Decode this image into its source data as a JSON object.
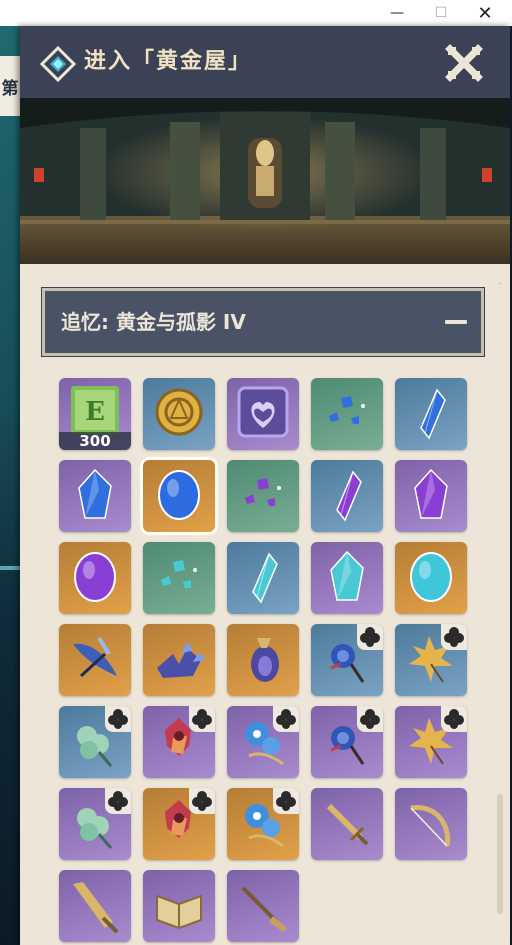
{
  "window": {
    "minimize_glyph": "—",
    "maximize_glyph": "☐",
    "close_glyph": "✕"
  },
  "background": {
    "side_tab_char": "第"
  },
  "panel": {
    "title": "进入「黄金屋」",
    "section_title": "追忆: 黄金与孤影 IV",
    "collapse_glyph": "—"
  },
  "rewards": [
    {
      "name": "adventure-exp-icon",
      "bg": "purple",
      "qty": "300",
      "color": "#7fbf5a"
    },
    {
      "name": "mora-coin-icon",
      "bg": "blue",
      "color": "#e0b243"
    },
    {
      "name": "companionship-exp-icon",
      "bg": "purple",
      "color": "#b7a6f0"
    },
    {
      "name": "hydro-gem-fragments-icon",
      "bg": "green",
      "color": "#2f6fe0"
    },
    {
      "name": "hydro-gem-sliver-icon",
      "bg": "blue",
      "color": "#2f6fe0"
    },
    {
      "name": "hydro-gem-fragment-icon",
      "bg": "purple",
      "color": "#2f6fe0"
    },
    {
      "name": "hydro-gem-chunk-icon",
      "bg": "gold",
      "selected": true,
      "color": "#2d6be0"
    },
    {
      "name": "electro-gem-fragments-icon",
      "bg": "green",
      "color": "#8a3fd4"
    },
    {
      "name": "electro-gem-sliver-icon",
      "bg": "blue",
      "color": "#8a3fd4"
    },
    {
      "name": "electro-gem-fragment-icon",
      "bg": "purple",
      "color": "#8a3fd4"
    },
    {
      "name": "electro-gem-chunk-icon",
      "bg": "gold",
      "color": "#8a3fd4"
    },
    {
      "name": "cryo-gem-fragments-icon",
      "bg": "green",
      "color": "#49c9d6"
    },
    {
      "name": "cryo-gem-sliver-icon",
      "bg": "blue",
      "color": "#49c9d6"
    },
    {
      "name": "cryo-gem-fragment-icon",
      "bg": "purple",
      "color": "#49c9d6"
    },
    {
      "name": "cryo-gem-chunk-icon",
      "bg": "gold",
      "color": "#3fc6d8"
    },
    {
      "name": "feather-artifact-blue-icon",
      "bg": "gold",
      "color": "#3e5fb8"
    },
    {
      "name": "flower-artifact-blue-icon",
      "bg": "gold",
      "color": "#4a4fa8"
    },
    {
      "name": "goblet-artifact-purple-icon",
      "bg": "gold",
      "color": "#4b4aa0"
    },
    {
      "name": "rose-artifact-icon",
      "bg": "blue",
      "badge": true,
      "color": "#2f55b8"
    },
    {
      "name": "maple-leaf-artifact-icon",
      "bg": "blue",
      "badge": true,
      "color": "#e6b44d"
    },
    {
      "name": "green-flower-artifact-icon",
      "bg": "blue",
      "badge": true,
      "color": "#9fd4b8"
    },
    {
      "name": "crimson-flower-artifact-icon",
      "bg": "purple",
      "badge": true,
      "color": "#c23c4e"
    },
    {
      "name": "morning-glory-artifact-icon",
      "bg": "purple",
      "badge": true,
      "color": "#3f8fdc"
    },
    {
      "name": "rose-artifact-icon-2",
      "bg": "purple",
      "badge": true,
      "color": "#2f55b8"
    },
    {
      "name": "maple-leaf-artifact-icon-2",
      "bg": "purple",
      "badge": true,
      "color": "#e6b44d"
    },
    {
      "name": "green-flower-artifact-icon-2",
      "bg": "purple",
      "badge": true,
      "color": "#9fd4b8"
    },
    {
      "name": "crimson-flower-artifact-icon-2",
      "bg": "gold",
      "badge": true,
      "color": "#c23c4e"
    },
    {
      "name": "morning-glory-artifact-icon-2",
      "bg": "gold",
      "badge": true,
      "color": "#3f8fdc"
    },
    {
      "name": "sword-weapon-icon",
      "bg": "purple",
      "color": "#d8b66a"
    },
    {
      "name": "bow-weapon-icon",
      "bg": "purple",
      "color": "#d8b66a"
    },
    {
      "name": "claymore-weapon-icon",
      "bg": "purple",
      "color": "#d8b66a"
    },
    {
      "name": "catalyst-book-icon",
      "bg": "purple",
      "color": "#e2cf9a"
    },
    {
      "name": "polearm-weapon-icon",
      "bg": "purple",
      "color": "#c9a060"
    }
  ],
  "palette": {
    "gold": [
      "#b57d36",
      "#e2a14a"
    ],
    "purple": [
      "#7e62a8",
      "#a98bcf"
    ],
    "blue": [
      "#4d7a9c",
      "#7aa3c4"
    ],
    "green": [
      "#4f8a74",
      "#79ae93"
    ]
  }
}
